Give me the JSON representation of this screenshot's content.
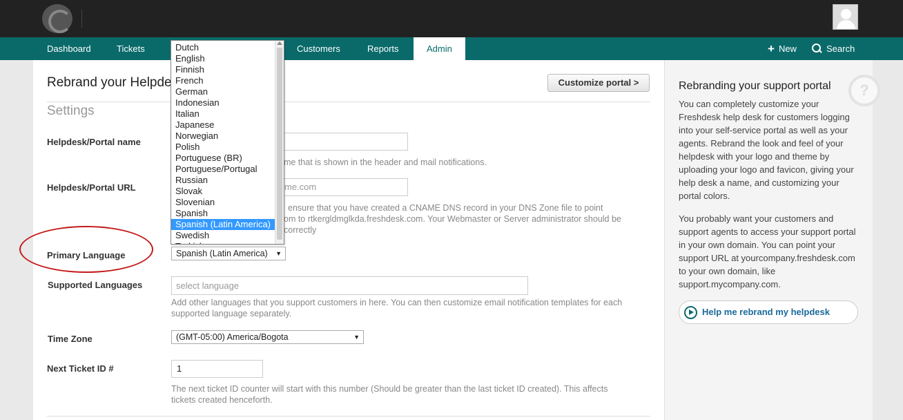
{
  "nav": {
    "items": [
      "Dashboard",
      "Tickets",
      "Customers",
      "Reports",
      "Admin"
    ],
    "new_label": "New",
    "search_label": "Search"
  },
  "page": {
    "title": "Rebrand your Helpdesk",
    "customize_button": "Customize portal >",
    "settings_heading": "Settings"
  },
  "form": {
    "portal_name": {
      "label": "Helpdesk/Portal name",
      "hint": "me that is shown in the header and mail notifications."
    },
    "portal_url": {
      "label": "Helpdesk/Portal URL",
      "value": "me.com",
      "hint_line1": "ensure that you have created a CNAME DNS record in your DNS Zone file to point",
      "hint_line2": "om to rtkergldmglkda.freshdesk.com. Your Webmaster or Server administrator should be",
      "hint_line3": "correctly"
    },
    "primary_language": {
      "label": "Primary Language",
      "selected": "Spanish (Latin America)"
    },
    "supported_languages": {
      "label": "Supported Languages",
      "placeholder": "select language",
      "hint_line1": "Add other languages that you support customers in here. You can then customize email notification templates for each",
      "hint_line2": "supported language separately."
    },
    "time_zone": {
      "label": "Time Zone",
      "selected": "(GMT-05:00) America/Bogota"
    },
    "next_ticket": {
      "label": "Next Ticket ID #",
      "value": "1",
      "hint_line1": "The next ticket ID counter will start with this number (Should be greater than the last ticket ID created). This affects",
      "hint_line2": "tickets created henceforth."
    }
  },
  "language_dropdown": {
    "options": [
      "Dutch",
      "English",
      "Finnish",
      "French",
      "German",
      "Indonesian",
      "Italian",
      "Japanese",
      "Norwegian",
      "Polish",
      "Portuguese (BR)",
      "Portuguese/Portugal",
      "Russian",
      "Slovak",
      "Slovenian",
      "Spanish",
      "Spanish (Latin America)",
      "Swedish",
      "Turkish"
    ],
    "highlighted": "Spanish (Latin America)"
  },
  "sidebar": {
    "title": "Rebranding your support portal",
    "para1": "You can completely customize your Freshdesk help desk for customers logging into your self-service portal as well as your agents. Rebrand the look and feel of your helpdesk with your logo and theme by uploading your logo and favicon, giving your help desk a name, and customizing your portal colors.",
    "para2": "You probably want your customers and support agents to access your support portal in your own domain. You can point your support URL at yourcompany.freshdesk.com to your own domain, like support.mycompany.com.",
    "help_button": "Help me rebrand my helpdesk"
  },
  "colors": {
    "topbar": "#222222",
    "navbar": "#0a6a6a",
    "highlight": "#3399ff",
    "annotation": "#c41a1a"
  }
}
